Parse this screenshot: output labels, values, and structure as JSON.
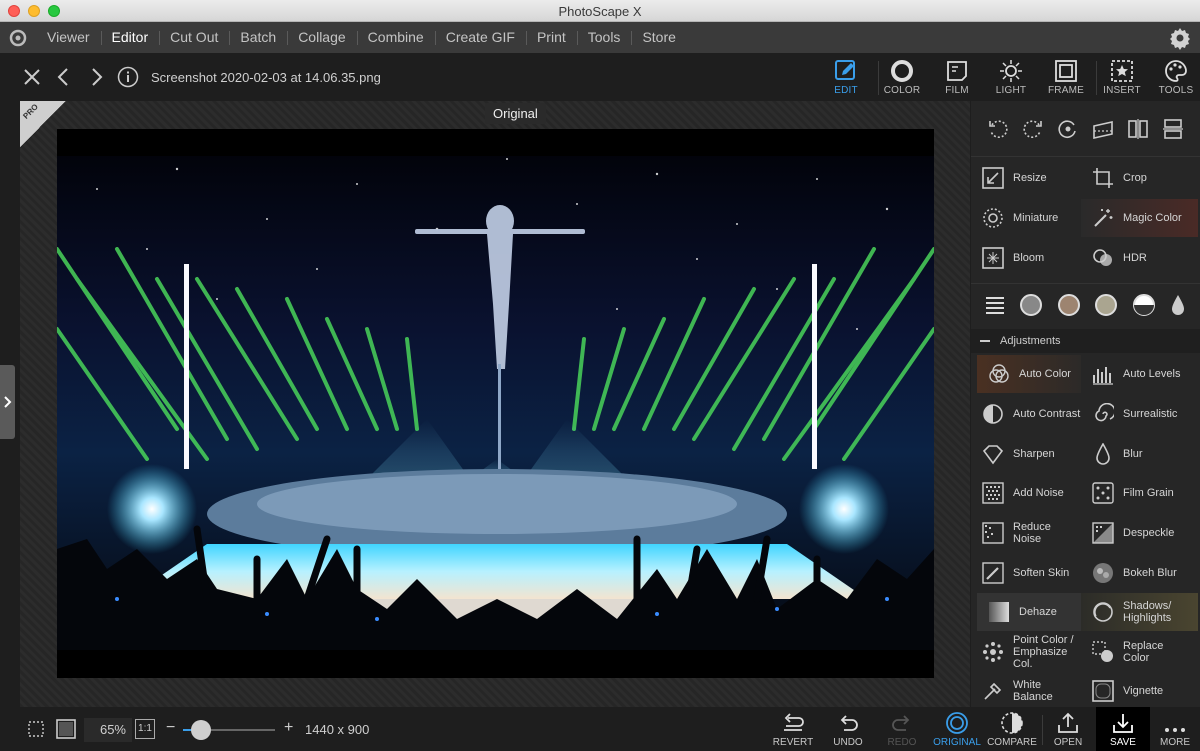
{
  "window": {
    "title": "PhotoScape X"
  },
  "menu": {
    "items": [
      "Viewer",
      "Editor",
      "Cut Out",
      "Batch",
      "Collage",
      "Combine",
      "Create GIF",
      "Print",
      "Tools",
      "Store"
    ],
    "active": "Editor"
  },
  "toolbar": {
    "filename": "Screenshot 2020-02-03 at 14.06.35.png",
    "tabs": [
      "EDIT",
      "COLOR",
      "FILM",
      "LIGHT",
      "FRAME",
      "INSERT",
      "TOOLS"
    ],
    "active_tab": "EDIT"
  },
  "canvas": {
    "original_label": "Original",
    "badge_text": "PRO"
  },
  "panel": {
    "tools": [
      {
        "label": "Resize",
        "icon": "resize-icon"
      },
      {
        "label": "Crop",
        "icon": "crop-icon"
      },
      {
        "label": "Miniature",
        "icon": "miniature-icon"
      },
      {
        "label": "Magic Color",
        "icon": "magic-wand-icon"
      },
      {
        "label": "Bloom",
        "icon": "bloom-icon"
      },
      {
        "label": "HDR",
        "icon": "hdr-icon"
      }
    ],
    "adjustments_header": "Adjustments",
    "adjustments": [
      {
        "label": "Auto Color",
        "icon": "auto-color-icon"
      },
      {
        "label": "Auto Levels",
        "icon": "auto-levels-icon"
      },
      {
        "label": "Auto Contrast",
        "icon": "auto-contrast-icon"
      },
      {
        "label": "Surrealistic",
        "icon": "surrealistic-icon"
      },
      {
        "label": "Sharpen",
        "icon": "sharpen-icon"
      },
      {
        "label": "Blur",
        "icon": "blur-icon"
      },
      {
        "label": "Add Noise",
        "icon": "add-noise-icon"
      },
      {
        "label": "Film Grain",
        "icon": "film-grain-icon"
      },
      {
        "label": "Reduce Noise",
        "icon": "reduce-noise-icon"
      },
      {
        "label": "Despeckle",
        "icon": "despeckle-icon"
      },
      {
        "label": "Soften Skin",
        "icon": "soften-skin-icon"
      },
      {
        "label": "Bokeh Blur",
        "icon": "bokeh-blur-icon"
      },
      {
        "label": "Dehaze",
        "icon": "dehaze-icon"
      },
      {
        "label": "Shadows/ Highlights",
        "icon": "shadows-highlights-icon"
      },
      {
        "label": "Point Color / Emphasize Col.",
        "icon": "point-color-icon"
      },
      {
        "label": "Replace Color",
        "icon": "replace-color-icon"
      },
      {
        "label": "White Balance",
        "icon": "white-balance-icon"
      },
      {
        "label": "Vignette",
        "icon": "vignette-icon"
      }
    ]
  },
  "bottom": {
    "zoom": "65%",
    "zoom_level": 0.2,
    "one_to_one": "1:1",
    "dimensions": "1440 x 900",
    "actions": [
      "REVERT",
      "UNDO",
      "REDO",
      "ORIGINAL",
      "COMPARE",
      "OPEN",
      "SAVE",
      "MORE"
    ]
  },
  "colors": {
    "accent": "#3a9eea",
    "laser": "#49d35a",
    "stage": "#2fb7e0"
  }
}
